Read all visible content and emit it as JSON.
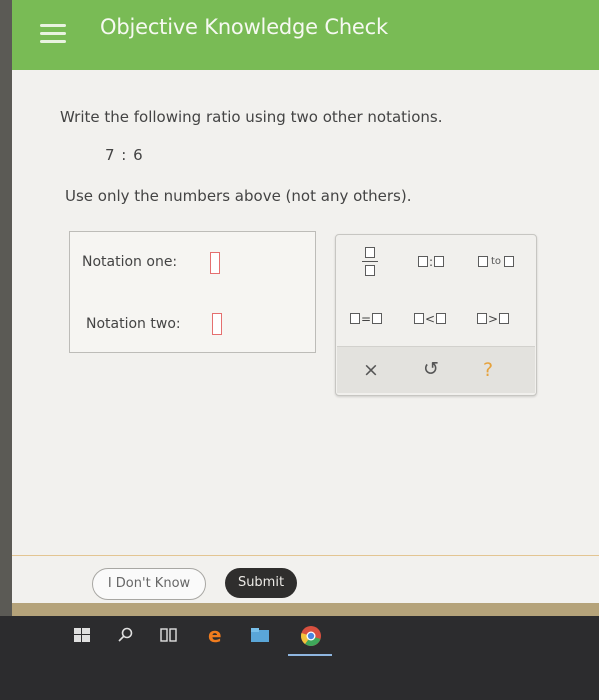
{
  "header": {
    "title": "Objective Knowledge Check",
    "menu_icon": "hamburger-menu-icon"
  },
  "question": {
    "prompt": "Write the following ratio using two other notations.",
    "ratio": "7 : 6",
    "instruction": "Use only the numbers above (not any others)."
  },
  "answers": {
    "notation_one_label": "Notation one:",
    "notation_two_label": "Notation two:"
  },
  "keypad": {
    "colon_symbol": ":",
    "to_label": "to",
    "equals_symbol": "=",
    "less_symbol": "<",
    "greater_symbol": ">",
    "clear_symbol": "×",
    "undo_symbol": "↺",
    "help_symbol": "?"
  },
  "footer": {
    "dont_know_label": "I Don't Know",
    "submit_label": "Submit"
  },
  "taskbar": {
    "icons": [
      "windows-start-icon",
      "search-icon",
      "task-view-icon",
      "edge-browser-icon",
      "file-explorer-icon",
      "chrome-icon"
    ]
  },
  "colors": {
    "header": "#79bb55",
    "slot_border": "#e56f6f",
    "submit_bg": "#2f2e2d",
    "help": "#e6a23c"
  }
}
